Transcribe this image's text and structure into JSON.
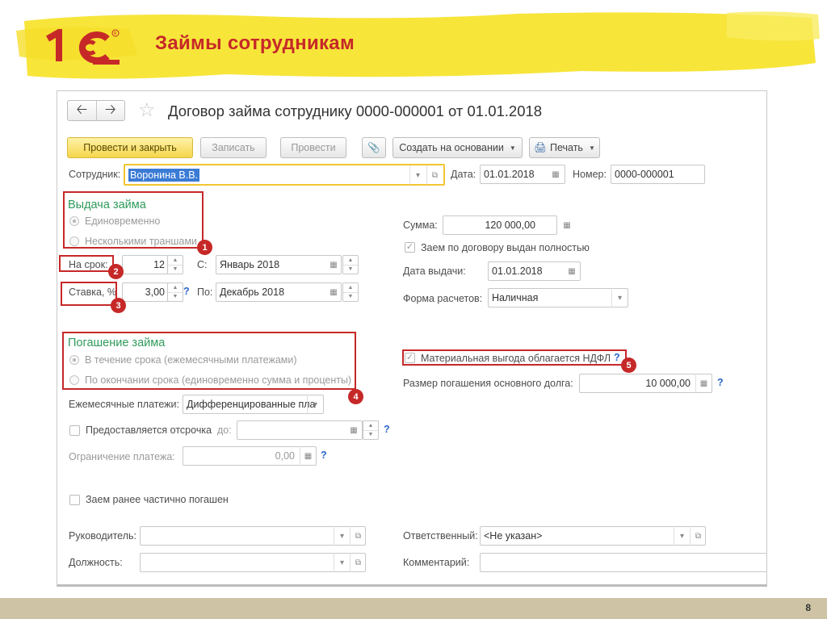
{
  "slide": {
    "title": "Займы сотрудникам",
    "page_number": "8"
  },
  "colors": {
    "highlight": "#f7e53a",
    "brand_red": "#c62828",
    "section_green": "#2f9b5b",
    "primary_button": "#f4d64b",
    "annotation": "#c62828",
    "footer": "#cfc3a6"
  },
  "window": {
    "title": "Договор займа сотруднику 0000-000001 от 01.01.2018"
  },
  "toolbar": {
    "post_close": "Провести и закрыть",
    "save": "Записать",
    "post": "Провести",
    "create_basis": "Создать на основании",
    "print": "Печать"
  },
  "form": {
    "employee_label": "Сотрудник:",
    "employee_value": "Воронина В.В.",
    "date_label": "Дата:",
    "date_value": "01.01.2018",
    "number_label": "Номер:",
    "number_value": "0000-000001",
    "issue_section": "Выдача займа",
    "issue_once": "Единовременно",
    "issue_tranches": "Несколькими траншами",
    "term_label": "На срок:",
    "term_value": "12",
    "from_label": "С:",
    "from_value": "Январь 2018",
    "rate_label": "Ставка, %",
    "rate_value": "3,00",
    "to_label": "По:",
    "to_value": "Декабрь 2018",
    "sum_label": "Сумма:",
    "sum_value": "120 000,00",
    "issued_full": "Заем по договору выдан полностью",
    "issue_date_label": "Дата выдачи:",
    "issue_date_value": "01.01.2018",
    "payment_form_label": "Форма расчетов:",
    "payment_form_value": "Наличная",
    "repay_section": "Погашение займа",
    "repay_monthly": "В течение срока (ежемесячными платежами)",
    "repay_end": "По окончании срока (единовременно сумма и проценты)",
    "monthly_label": "Ежемесячные платежи:",
    "monthly_value": "Дифференцированные пла",
    "deferral_label": "Предоставляется отсрочка",
    "deferral_to": "до:",
    "limit_label": "Ограничение платежа:",
    "limit_value": "0,00",
    "partial_repaid": "Заем ранее частично погашен",
    "benefit_label": "Материальная выгода облагается НДФЛ",
    "principal_label": "Размер погашения основного долга:",
    "principal_value": "10 000,00",
    "manager_label": "Руководитель:",
    "position_label": "Должность:",
    "responsible_label": "Ответственный:",
    "responsible_value": "<Не указан>",
    "comment_label": "Комментарий:",
    "help": "?"
  },
  "annotations": [
    "1",
    "2",
    "3",
    "4",
    "5"
  ]
}
